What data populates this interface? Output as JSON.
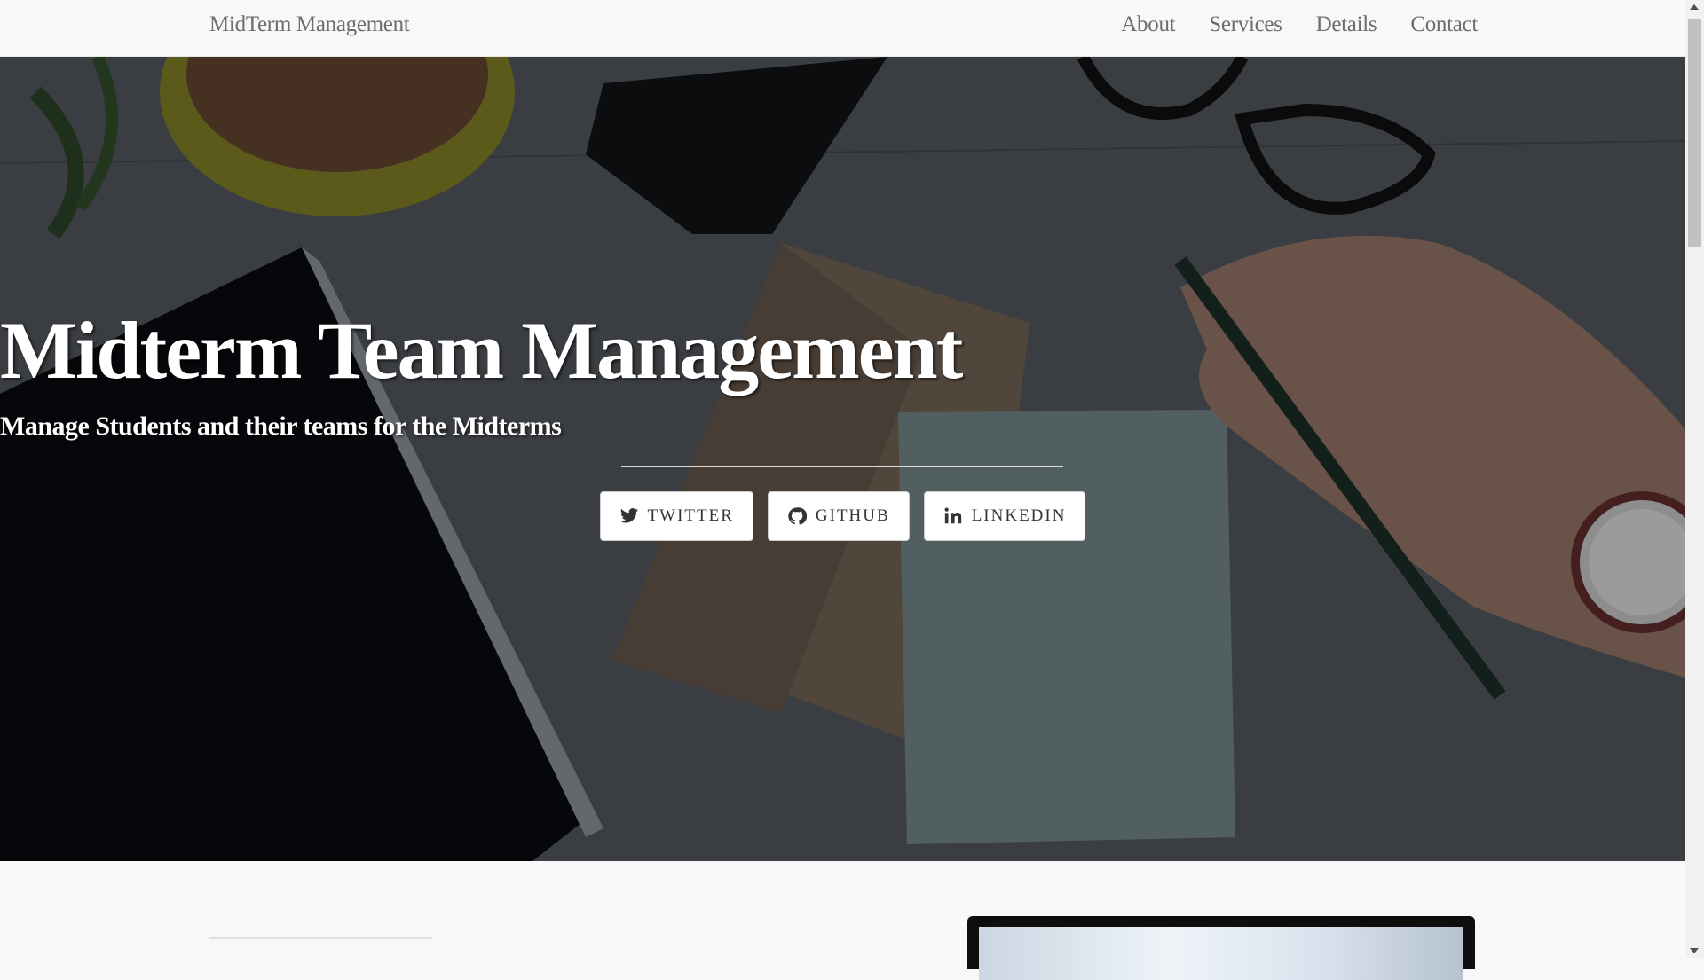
{
  "nav": {
    "brand": "MidTerm Management",
    "links": [
      "About",
      "Services",
      "Details",
      "Contact"
    ]
  },
  "hero": {
    "title": "Midterm Team Management",
    "subtitle": "Manage Students and their teams for the Midterms",
    "buttons": [
      {
        "label": "Twitter",
        "icon": "twitter-icon"
      },
      {
        "label": "Github",
        "icon": "github-icon"
      },
      {
        "label": "Linkedin",
        "icon": "linkedin-icon"
      }
    ]
  },
  "colors": {
    "navbar_bg": "#f8f8f8",
    "nav_text": "#6d6d6d",
    "hero_text": "#ffffff",
    "button_bg": "#ffffff"
  }
}
